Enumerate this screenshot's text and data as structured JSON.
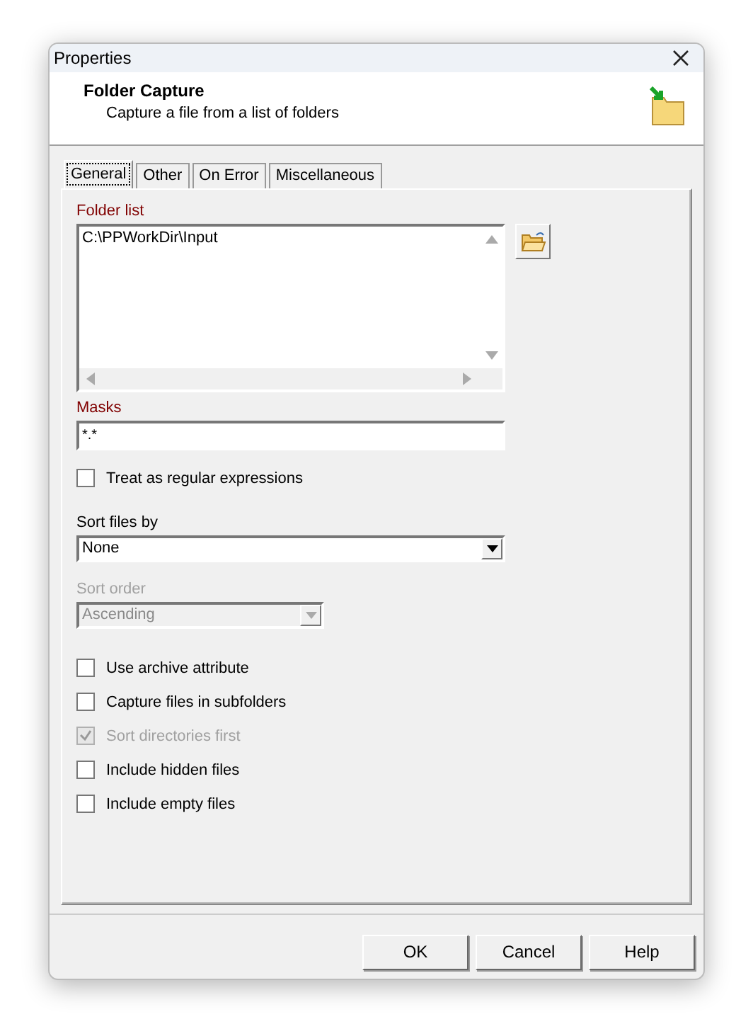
{
  "window": {
    "title": "Properties"
  },
  "header": {
    "title": "Folder Capture",
    "subtitle": "Capture a file from a list of folders"
  },
  "tabs": [
    {
      "label": "General",
      "selected": true
    },
    {
      "label": "Other",
      "selected": false
    },
    {
      "label": "On Error",
      "selected": false
    },
    {
      "label": "Miscellaneous",
      "selected": false
    }
  ],
  "folder_list": {
    "label": "Folder list",
    "items": [
      "C:\\PPWorkDir\\Input"
    ]
  },
  "masks": {
    "label": "Masks",
    "value": "*.*"
  },
  "regex": {
    "label": "Treat as regular expressions",
    "checked": false,
    "disabled": false
  },
  "sort_files_by": {
    "label": "Sort files by",
    "value": "None",
    "disabled": false
  },
  "sort_order": {
    "label": "Sort order",
    "value": "Ascending",
    "disabled": true
  },
  "options": [
    {
      "label": "Use archive attribute",
      "checked": false,
      "disabled": false
    },
    {
      "label": "Capture files in subfolders",
      "checked": false,
      "disabled": false
    },
    {
      "label": "Sort directories first",
      "checked": true,
      "disabled": true
    },
    {
      "label": "Include hidden files",
      "checked": false,
      "disabled": false
    },
    {
      "label": "Include empty files",
      "checked": false,
      "disabled": false
    }
  ],
  "buttons": [
    "OK",
    "Cancel",
    "Help"
  ]
}
